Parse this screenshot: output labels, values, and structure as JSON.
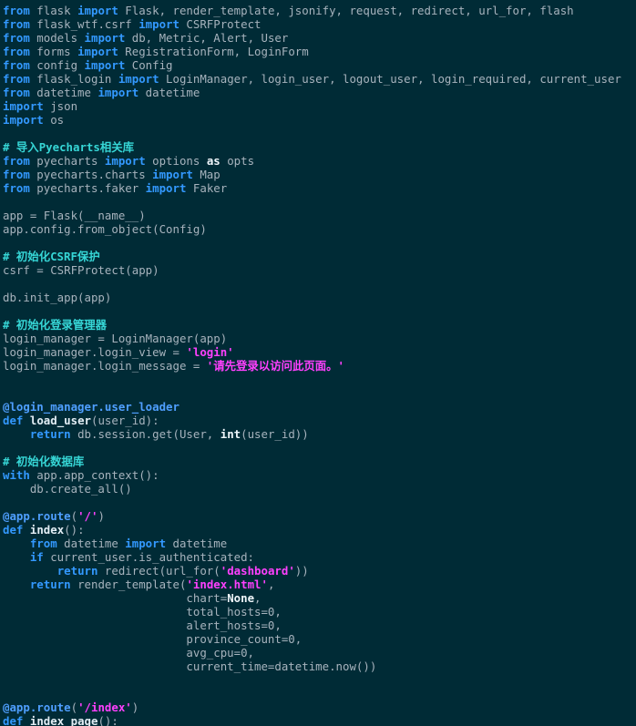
{
  "editor": {
    "language": "python",
    "colors": {
      "background": "#002b36",
      "text": "#a7b3bd",
      "keyword": "#3399ff",
      "comment": "#36d6d6",
      "string": "#ff40ff",
      "decorator": "#4f9fff",
      "function_name": "#e3eef5"
    },
    "lines": [
      [
        {
          "t": "from",
          "s": "kw"
        },
        {
          "t": " flask ",
          "s": "txt"
        },
        {
          "t": "import",
          "s": "kw"
        },
        {
          "t": " Flask, render_template, jsonify, request, redirect, url_for, flash",
          "s": "txt"
        }
      ],
      [
        {
          "t": "from",
          "s": "kw"
        },
        {
          "t": " flask_wtf.csrf ",
          "s": "txt"
        },
        {
          "t": "import",
          "s": "kw"
        },
        {
          "t": " CSRFProtect",
          "s": "txt"
        }
      ],
      [
        {
          "t": "from",
          "s": "kw"
        },
        {
          "t": " models ",
          "s": "txt"
        },
        {
          "t": "import",
          "s": "kw"
        },
        {
          "t": " db, Metric, Alert, User",
          "s": "txt"
        }
      ],
      [
        {
          "t": "from",
          "s": "kw"
        },
        {
          "t": " forms ",
          "s": "txt"
        },
        {
          "t": "import",
          "s": "kw"
        },
        {
          "t": " RegistrationForm, LoginForm",
          "s": "txt"
        }
      ],
      [
        {
          "t": "from",
          "s": "kw"
        },
        {
          "t": " config ",
          "s": "txt"
        },
        {
          "t": "import",
          "s": "kw"
        },
        {
          "t": " Config",
          "s": "txt"
        }
      ],
      [
        {
          "t": "from",
          "s": "kw"
        },
        {
          "t": " flask_login ",
          "s": "txt"
        },
        {
          "t": "import",
          "s": "kw"
        },
        {
          "t": " LoginManager, login_user, logout_user, login_required, current_user",
          "s": "txt"
        }
      ],
      [
        {
          "t": "from",
          "s": "kw"
        },
        {
          "t": " datetime ",
          "s": "txt"
        },
        {
          "t": "import",
          "s": "kw"
        },
        {
          "t": " datetime",
          "s": "txt"
        }
      ],
      [
        {
          "t": "import",
          "s": "kw"
        },
        {
          "t": " json",
          "s": "txt"
        }
      ],
      [
        {
          "t": "import",
          "s": "kw"
        },
        {
          "t": " os",
          "s": "txt"
        }
      ],
      [],
      [
        {
          "t": "# 导入Pyecharts相关库",
          "s": "cm"
        }
      ],
      [
        {
          "t": "from",
          "s": "kw"
        },
        {
          "t": " pyecharts ",
          "s": "txt"
        },
        {
          "t": "import",
          "s": "kw"
        },
        {
          "t": " options ",
          "s": "txt"
        },
        {
          "t": "as",
          "s": "kw2"
        },
        {
          "t": " opts",
          "s": "txt"
        }
      ],
      [
        {
          "t": "from",
          "s": "kw"
        },
        {
          "t": " pyecharts.charts ",
          "s": "txt"
        },
        {
          "t": "import",
          "s": "kw"
        },
        {
          "t": " Map",
          "s": "txt"
        }
      ],
      [
        {
          "t": "from",
          "s": "kw"
        },
        {
          "t": " pyecharts.faker ",
          "s": "txt"
        },
        {
          "t": "import",
          "s": "kw"
        },
        {
          "t": " Faker",
          "s": "txt"
        }
      ],
      [],
      [
        {
          "t": "app = Flask(__name__)",
          "s": "txt"
        }
      ],
      [
        {
          "t": "app.config.from_object(Config)",
          "s": "txt"
        }
      ],
      [],
      [
        {
          "t": "# 初始化CSRF保护",
          "s": "cm"
        }
      ],
      [
        {
          "t": "csrf = CSRFProtect(app)",
          "s": "txt"
        }
      ],
      [],
      [
        {
          "t": "db.init_app(app)",
          "s": "txt"
        }
      ],
      [],
      [
        {
          "t": "# 初始化登录管理器",
          "s": "cm"
        }
      ],
      [
        {
          "t": "login_manager = LoginManager(app)",
          "s": "txt"
        }
      ],
      [
        {
          "t": "login_manager.login_view = ",
          "s": "txt"
        },
        {
          "t": "'login'",
          "s": "str"
        }
      ],
      [
        {
          "t": "login_manager.login_message = ",
          "s": "txt"
        },
        {
          "t": "'请先登录以访问此页面。'",
          "s": "str"
        }
      ],
      [],
      [],
      [
        {
          "t": "@login_manager.user_loader",
          "s": "dec"
        }
      ],
      [
        {
          "t": "def",
          "s": "kw"
        },
        {
          "t": " ",
          "s": "txt"
        },
        {
          "t": "load_user",
          "s": "fn"
        },
        {
          "t": "(user_id):",
          "s": "txt"
        }
      ],
      [
        {
          "t": "    ",
          "s": "txt"
        },
        {
          "t": "return",
          "s": "kw"
        },
        {
          "t": " db.session.get(User, ",
          "s": "txt"
        },
        {
          "t": "int",
          "s": "kw2"
        },
        {
          "t": "(user_id))",
          "s": "txt"
        }
      ],
      [],
      [
        {
          "t": "# 初始化数据库",
          "s": "cm"
        }
      ],
      [
        {
          "t": "with",
          "s": "kw"
        },
        {
          "t": " app.app_context():",
          "s": "txt"
        }
      ],
      [
        {
          "t": "    db.create_all()",
          "s": "txt"
        }
      ],
      [],
      [
        {
          "t": "@app.route",
          "s": "dec"
        },
        {
          "t": "(",
          "s": "txt"
        },
        {
          "t": "'/'",
          "s": "str"
        },
        {
          "t": ")",
          "s": "txt"
        }
      ],
      [
        {
          "t": "def",
          "s": "kw"
        },
        {
          "t": " ",
          "s": "txt"
        },
        {
          "t": "index",
          "s": "fn"
        },
        {
          "t": "():",
          "s": "txt"
        }
      ],
      [
        {
          "t": "    ",
          "s": "txt"
        },
        {
          "t": "from",
          "s": "kw"
        },
        {
          "t": " datetime ",
          "s": "txt"
        },
        {
          "t": "import",
          "s": "kw"
        },
        {
          "t": " datetime",
          "s": "txt"
        }
      ],
      [
        {
          "t": "    ",
          "s": "txt"
        },
        {
          "t": "if",
          "s": "kw"
        },
        {
          "t": " current_user.is_authenticated:",
          "s": "txt"
        }
      ],
      [
        {
          "t": "        ",
          "s": "txt"
        },
        {
          "t": "return",
          "s": "kw"
        },
        {
          "t": " redirect(url_for(",
          "s": "txt"
        },
        {
          "t": "'dashboard'",
          "s": "str"
        },
        {
          "t": "))",
          "s": "txt"
        }
      ],
      [
        {
          "t": "    ",
          "s": "txt"
        },
        {
          "t": "return",
          "s": "kw"
        },
        {
          "t": " render_template(",
          "s": "txt"
        },
        {
          "t": "'index.html'",
          "s": "str"
        },
        {
          "t": ",",
          "s": "txt"
        }
      ],
      [
        {
          "t": "                           chart=",
          "s": "txt"
        },
        {
          "t": "None",
          "s": "kw2"
        },
        {
          "t": ",",
          "s": "txt"
        }
      ],
      [
        {
          "t": "                           total_hosts=0,",
          "s": "txt"
        }
      ],
      [
        {
          "t": "                           alert_hosts=0,",
          "s": "txt"
        }
      ],
      [
        {
          "t": "                           province_count=0,",
          "s": "txt"
        }
      ],
      [
        {
          "t": "                           avg_cpu=0,",
          "s": "txt"
        }
      ],
      [
        {
          "t": "                           current_time=datetime.now())",
          "s": "txt"
        }
      ],
      [],
      [],
      [
        {
          "t": "@app.route",
          "s": "dec"
        },
        {
          "t": "(",
          "s": "txt"
        },
        {
          "t": "'/index'",
          "s": "str"
        },
        {
          "t": ")",
          "s": "txt"
        }
      ],
      [
        {
          "t": "def",
          "s": "kw"
        },
        {
          "t": " ",
          "s": "txt"
        },
        {
          "t": "index_page",
          "s": "fn"
        },
        {
          "t": "():",
          "s": "txt"
        }
      ]
    ]
  }
}
